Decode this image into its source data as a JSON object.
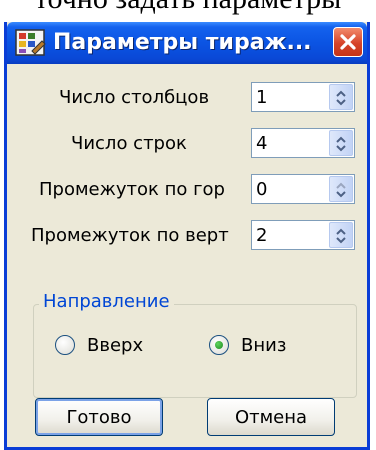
{
  "background_caption": "точно задать параметры",
  "dialog": {
    "title": "Параметры тираж...",
    "fields": [
      {
        "label": "Число столбцов",
        "value": "1"
      },
      {
        "label": "Число строк",
        "value": "4"
      },
      {
        "label": "Промежуток по гор",
        "value": "0"
      },
      {
        "label": "Промежуток по верт",
        "value": "2"
      }
    ],
    "direction": {
      "legend": "Направление",
      "options": [
        {
          "label": "Вверх",
          "selected": false
        },
        {
          "label": "Вниз",
          "selected": true
        }
      ]
    },
    "buttons": {
      "ok": "Готово",
      "cancel": "Отмена"
    }
  },
  "colors": {
    "titlebar": "#0a54e3",
    "close": "#d6442a",
    "face": "#ece9d8",
    "accent_text": "#0046d5"
  },
  "icons": {
    "app": "table-pattern-icon",
    "close": "close-icon",
    "spin": "spin-up-down-icon",
    "radio": "radio-button-icon"
  }
}
